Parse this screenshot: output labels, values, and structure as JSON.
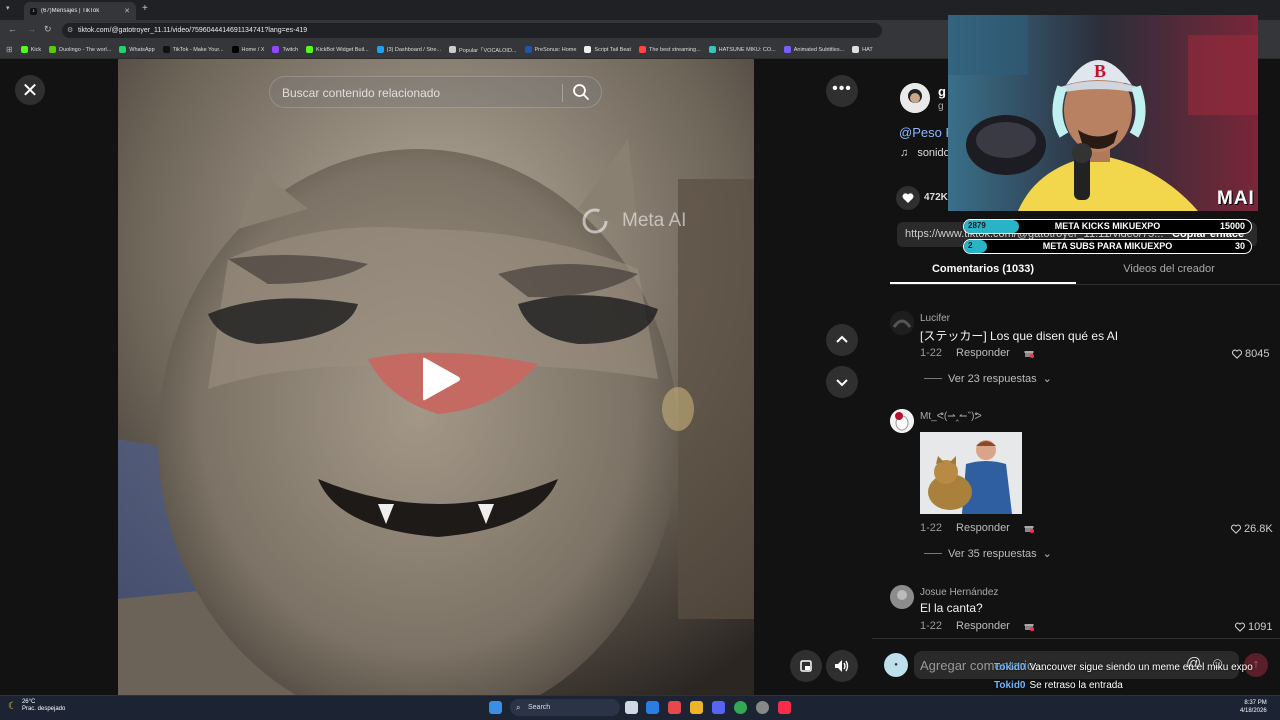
{
  "browser": {
    "tab_title": "(67)Mensajes | TikTok",
    "url": "tiktok.com/@gatotroyer_11.11/video/7596044414691134741?lang=es-419",
    "bookmarks": [
      {
        "label": "Kick",
        "color": "#53fc18"
      },
      {
        "label": "Duolingo - The worl...",
        "color": "#58cc02"
      },
      {
        "label": "WhatsApp",
        "color": "#25d366"
      },
      {
        "label": "TikTok - Make Your...",
        "color": "#111111"
      },
      {
        "label": "Home / X",
        "color": "#000000"
      },
      {
        "label": "Twitch",
        "color": "#9146ff"
      },
      {
        "label": "KickBot Widget Buil...",
        "color": "#53fc18"
      },
      {
        "label": "(3) Dashboard / Stre...",
        "color": "#1da1f2"
      },
      {
        "label": "Popular「VOCALOID...",
        "color": "#cccccc"
      },
      {
        "label": "PreSonus: Home",
        "color": "#2255aa"
      },
      {
        "label": "Script Tail Beat",
        "color": "#eeeeee"
      },
      {
        "label": "The best streaming...",
        "color": "#ff4444"
      },
      {
        "label": "HATSUNE MIKU: CO...",
        "color": "#39c5bb"
      },
      {
        "label": "Animated Subtitles...",
        "color": "#7a5cff"
      },
      {
        "label": "HAT",
        "color": "#dddddd"
      }
    ]
  },
  "video": {
    "search_placeholder": "Buscar contenido relacionado",
    "watermark": "Meta AI"
  },
  "sidebar": {
    "author_name": "g",
    "author_sub": "g",
    "description_link": "@Peso P",
    "sound": "sonido",
    "likes": "472K",
    "share_url": "https://www.tiktok.com/@gatotroyer_11.11/video/75...",
    "copy_link": "Copiar enlace",
    "tab_comments": "Comentarios (1033)",
    "tab_creator": "Videos del creador",
    "comment_placeholder": "Agregar comentario..."
  },
  "comments": [
    {
      "user": "Lucifer",
      "text": "[ステッカー] Los que disen qué es AI",
      "date": "1-22",
      "reply": "Responder",
      "likes": "8045",
      "replies": "Ver 23 respuestas"
    },
    {
      "user": "Mt_ᕙ(⇀‸↼‶)ᕗ",
      "text": "",
      "date": "1-22",
      "reply": "Responder",
      "likes": "26.8K",
      "replies": "Ver 35 respuestas"
    },
    {
      "user": "Josue Hernández",
      "text": "El la canta?",
      "date": "1-22",
      "reply": "Responder",
      "likes": "1091"
    }
  ],
  "stream": {
    "cam_label": "MAI",
    "goals": [
      {
        "current": "2879",
        "label": "META KICKS MIKUEXPO",
        "total": "15000",
        "progress": 0.19
      },
      {
        "current": "2",
        "label": "META SUBS PARA MIKUEXPO",
        "total": "30",
        "progress": 0.07
      }
    ],
    "chat": [
      {
        "user": "Tokid0",
        "msg": "Vancouver sigue siendo un meme en el miku expo"
      },
      {
        "user": "Tokid0",
        "msg": "Se retraso la entrada"
      }
    ]
  },
  "taskbar": {
    "temp": "26°C",
    "weather": "Prac. despejado",
    "search": "Search",
    "time": "8:37 PM",
    "date": "4/18/2026"
  },
  "colors": {
    "accent_red": "#fe2c55",
    "link_blue": "#8fb8ff",
    "goal_fill": "#29b3c6"
  }
}
